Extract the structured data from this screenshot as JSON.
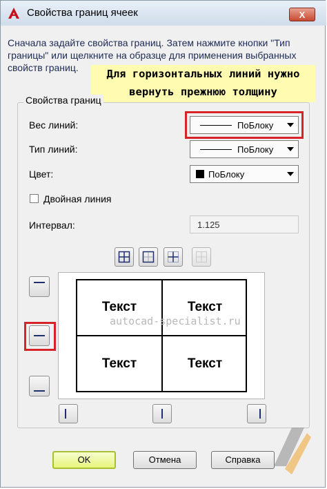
{
  "window": {
    "title": "Свойства границ ячеек",
    "close_label": "X"
  },
  "instructions": "Сначала задайте свойства границ. Затем нажмите кнопки \"Тип границы\" или щелкните на образце для применения выбранных свойств границ.",
  "annotation": {
    "line1": "Для горизонтальных линий нужно",
    "line2": "вернуть прежнюю толщину",
    "color": "#fffbb0"
  },
  "border_properties": {
    "group_title": "Свойства границ",
    "lineweight": {
      "label": "Вес линий:",
      "value": "ПоБлоку"
    },
    "linetype": {
      "label": "Тип линий:",
      "value": "ПоБлоку"
    },
    "color": {
      "label": "Цвет:",
      "value": "ПоБлоку",
      "swatch": "#000000"
    },
    "double_line": {
      "label": "Двойная линия",
      "checked": false
    },
    "spacing": {
      "label": "Интервал:",
      "value": "1.125"
    }
  },
  "preview": {
    "cells": [
      "Текст",
      "Текст",
      "Текст",
      "Текст"
    ],
    "watermark": "autocad-specialist.ru"
  },
  "border_buttons": [
    "all-borders-icon",
    "outside-borders-icon",
    "inside-borders-icon",
    "no-border-icon"
  ],
  "side_buttons": [
    "top-border-icon",
    "inside-horizontal-border-icon",
    "bottom-border-icon",
    "left-border-icon",
    "inside-vertical-border-icon",
    "right-border-icon"
  ],
  "highlight_color": "#d6232a",
  "buttons": {
    "ok": "OK",
    "cancel": "Отмена",
    "help": "Справка"
  }
}
